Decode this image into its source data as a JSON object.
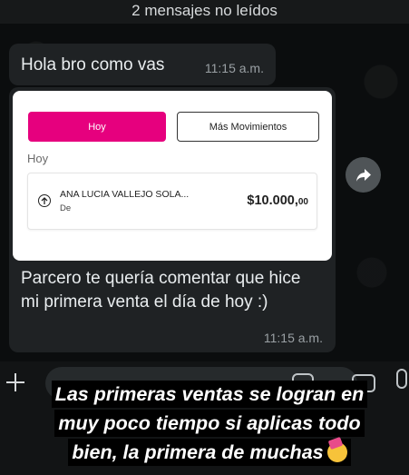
{
  "banner": {
    "text": "2 mensajes no leídos"
  },
  "message1": {
    "text": "Hola bro como vas",
    "time": "11:15 a.m."
  },
  "card": {
    "tab_active": "Hoy",
    "tab_other": "Más Movimientos",
    "section": "Hoy",
    "transaction": {
      "name": "ANA LUCIA VALLEJO SOLA...",
      "sub": "De",
      "amount_main": "$10.000,",
      "amount_cents": "00"
    },
    "colors": {
      "primary": "#e6007e"
    }
  },
  "message2": {
    "text": "Parcero te quería comentar que hice mi primera venta el día de hoy :)",
    "time": "11:15 a.m."
  },
  "caption": {
    "lines": [
      "Las primeras ventas se logran en",
      "muy poco tiempo si aplicas todo",
      "bien, la primera de muchas"
    ],
    "emoji": "party-face-icon"
  },
  "icons": {
    "forward": "forward-arrow-icon",
    "plus": "plus-icon",
    "sticker": "sticker-icon",
    "camera": "camera-icon",
    "mic": "microphone-icon"
  }
}
